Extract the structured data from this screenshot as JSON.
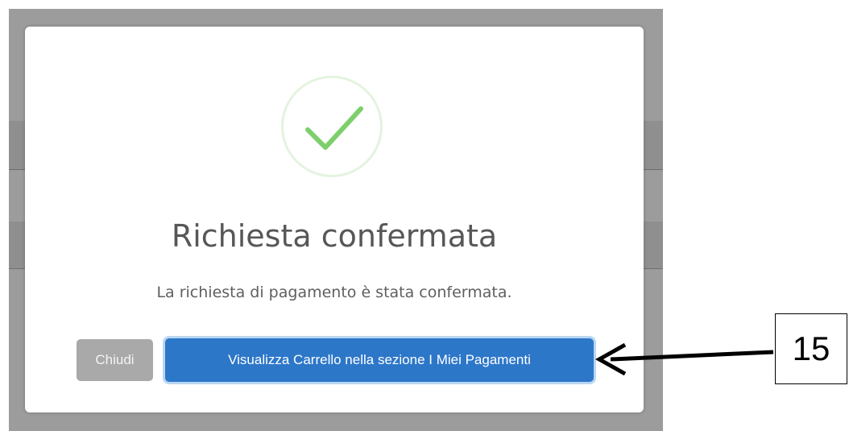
{
  "dialog": {
    "title": "Richiesta confermata",
    "message": "La richiesta di pagamento è stata confermata.",
    "icon": "success-check-icon",
    "buttons": {
      "close_label": "Chiudi",
      "primary_label": "Visualizza Carrello nella sezione I Miei Pagamenti"
    }
  },
  "annotation": {
    "step_number": "15"
  },
  "colors": {
    "overlay": "#9c9c9c",
    "primary_button": "#2d77c9",
    "close_button": "#a9a9a9",
    "check": "#7ccf6b",
    "check_ring": "#e4f3df"
  }
}
